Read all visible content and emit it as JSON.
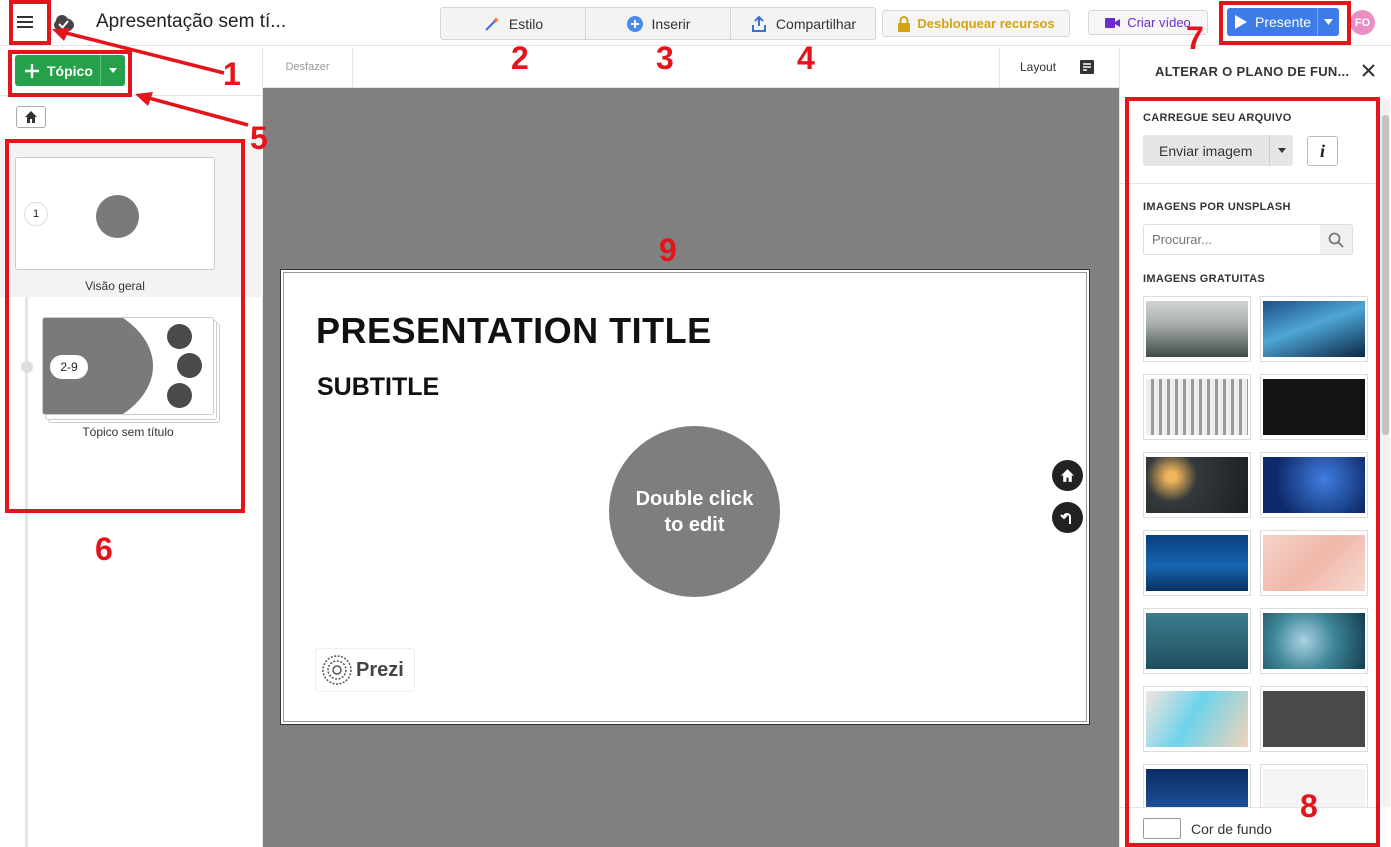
{
  "header": {
    "title": "Apresentação sem tí...",
    "tabs": [
      "Estilo",
      "Inserir",
      "Compartilhar"
    ],
    "unlock_label": "Desbloquear recursos",
    "video_label": "Criar vídeo",
    "present_label": "Presente",
    "avatar_initials": "FO"
  },
  "toolbar": {
    "undo_label": "Desfazer",
    "layout_label": "Layout"
  },
  "sidebar": {
    "topic_button_label": "Tópico",
    "overview": {
      "number": "1",
      "label": "Visão geral"
    },
    "topic": {
      "range": "2-9",
      "label": "Tópico sem título"
    }
  },
  "slide": {
    "title": "PRESENTATION TITLE",
    "subtitle": "SUBTITLE",
    "circle_text_line1": "Double click",
    "circle_text_line2": "to edit",
    "logo_text": "Prezi"
  },
  "panel": {
    "title": "ALTERAR O PLANO DE FUN...",
    "upload_section": "CARREGUE SEU ARQUIVO",
    "upload_button": "Enviar imagem",
    "info_icon": "i",
    "unsplash_section": "IMAGENS POR UNSPLASH",
    "search_placeholder": "Procurar...",
    "free_section": "IMAGENS GRATUITAS",
    "bg_color_label": "Cor de fundo"
  },
  "annotations": [
    "1",
    "2",
    "3",
    "4",
    "5",
    "6",
    "7",
    "8",
    "9"
  ],
  "colors": {
    "accent_green": "#27a04a",
    "present_blue": "#3c7be8",
    "unlock_gold": "#d4a313",
    "video_purple": "#6a2ccf",
    "annotation_red": "#e5141b"
  }
}
